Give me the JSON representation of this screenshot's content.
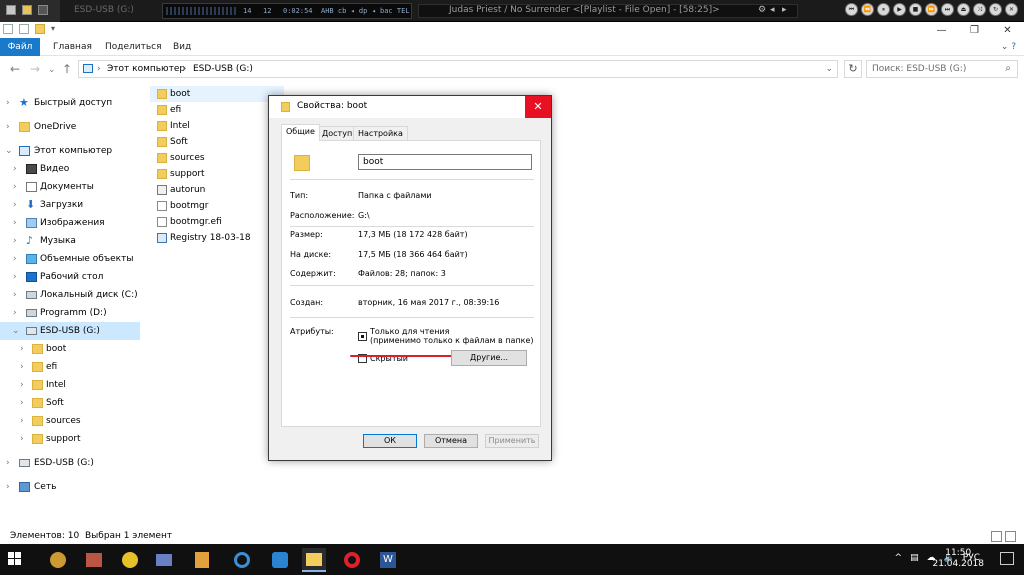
{
  "winamp": {
    "display_left": "14",
    "display_mid": "12",
    "display_time": "0:02:54",
    "display_flags": "AHB  cb  ◂  dp  ◂  bac  TEL",
    "track_title": "Judas Priest / No Surrender   <[Playlist - File Open] - [58:25]>",
    "ghost_title": "ESD-USB (G:)"
  },
  "explorer": {
    "ribbon": {
      "file": "Файл",
      "home": "Главная",
      "share": "Поделиться",
      "view": "Вид"
    },
    "address": {
      "crumb1": "Этот компьютер",
      "crumb2": "ESD-USB (G:)",
      "sep": "›"
    },
    "search_placeholder": "Поиск: ESD-USB (G:)",
    "sidebar": [
      {
        "label": "Быстрый доступ",
        "icon": "star-icon"
      },
      {
        "label": "OneDrive",
        "icon": "onedrive-icon"
      },
      {
        "label": "Этот компьютер",
        "icon": "computer-icon"
      },
      {
        "label": "Видео",
        "icon": "video-icon"
      },
      {
        "label": "Документы",
        "icon": "documents-icon"
      },
      {
        "label": "Загрузки",
        "icon": "downloads-icon"
      },
      {
        "label": "Изображения",
        "icon": "images-icon"
      },
      {
        "label": "Музыка",
        "icon": "music-icon"
      },
      {
        "label": "Объемные объекты",
        "icon": "3d-objects-icon"
      },
      {
        "label": "Рабочий стол",
        "icon": "desktop-icon"
      },
      {
        "label": "Локальный диск (C:)",
        "icon": "drive-icon"
      },
      {
        "label": "Programm (D:)",
        "icon": "drive-icon"
      },
      {
        "label": "ESD-USB (G:)",
        "icon": "usb-drive-icon"
      },
      {
        "label": "boot",
        "icon": "folder-icon"
      },
      {
        "label": "efi",
        "icon": "folder-icon"
      },
      {
        "label": "Intel",
        "icon": "folder-icon"
      },
      {
        "label": "Soft",
        "icon": "folder-icon"
      },
      {
        "label": "sources",
        "icon": "folder-icon"
      },
      {
        "label": "support",
        "icon": "folder-icon"
      },
      {
        "label": "ESD-USB (G:)",
        "icon": "usb-drive-icon"
      },
      {
        "label": "Сеть",
        "icon": "network-icon"
      }
    ],
    "files": [
      {
        "name": "boot",
        "icon": "folder-icon"
      },
      {
        "name": "efi",
        "icon": "folder-icon"
      },
      {
        "name": "Intel",
        "icon": "folder-icon"
      },
      {
        "name": "Soft",
        "icon": "folder-icon"
      },
      {
        "name": "sources",
        "icon": "folder-icon"
      },
      {
        "name": "support",
        "icon": "folder-icon"
      },
      {
        "name": "autorun",
        "icon": "setup-icon"
      },
      {
        "name": "bootmgr",
        "icon": "file-icon"
      },
      {
        "name": "bootmgr.efi",
        "icon": "file-icon"
      },
      {
        "name": "Registry 18-03-18",
        "icon": "registry-icon"
      }
    ],
    "status": {
      "items": "Элементов: 10",
      "selected": "Выбран 1 элемент"
    }
  },
  "dialog": {
    "title": "Свойства: boot",
    "close": "✕",
    "tabs": [
      "Общие",
      "Доступ",
      "Настройка"
    ],
    "name_value": "boot",
    "type_label": "Тип:",
    "type_value": "Папка с файлами",
    "location_label": "Расположение:",
    "location_value": "G:\\",
    "size_label": "Размер:",
    "size_value": "17,3 МБ (18 172 428 байт)",
    "ondisk_label": "На диске:",
    "ondisk_value": "17,5 МБ (18 366 464 байт)",
    "contains_label": "Содержит:",
    "contains_value": "Файлов: 28; папок: 3",
    "created_label": "Создан:",
    "created_value": "вторник, 16 мая 2017 г., 08:39:16",
    "attributes_label": "Атрибуты:",
    "readonly_label": "Только для чтения",
    "readonly_note": "(применимо только к файлам в папке)",
    "hidden_label": "Скрытый",
    "other_button": "Другие...",
    "ok": "ОК",
    "cancel": "Отмена",
    "apply": "Применить",
    "accent_red": "#d8212c"
  },
  "taskbar": {
    "lang": "РУС",
    "time": "11:50",
    "date": "21.04.2018",
    "apps": [
      "winamp-icon",
      "browser-icon",
      "app-icon",
      "fl-studio-icon",
      "ccleaner-icon",
      "teamviewer-icon",
      "explorer-icon",
      "opera-icon",
      "word-icon"
    ]
  }
}
